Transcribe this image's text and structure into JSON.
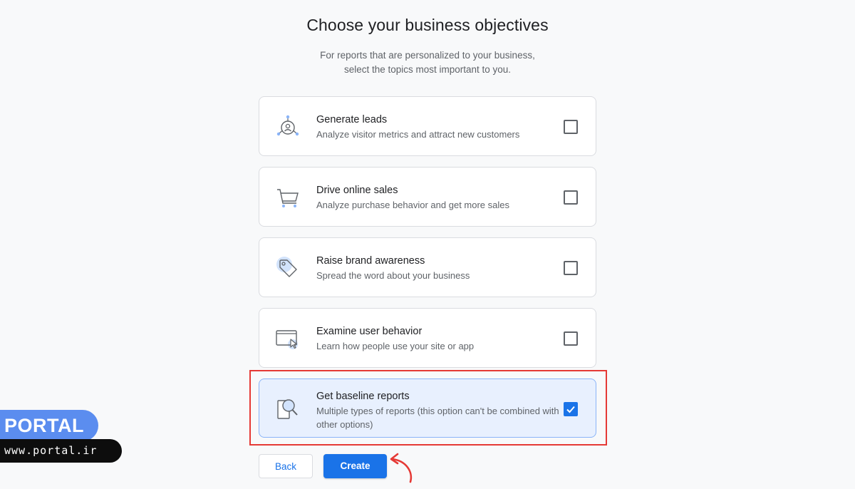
{
  "header": {
    "title": "Choose your business objectives",
    "subtitle_line1": "For reports that are personalized to your business,",
    "subtitle_line2": "select the topics most important to you."
  },
  "objectives": [
    {
      "title": "Generate leads",
      "description": "Analyze visitor metrics and attract new customers",
      "icon": "leads-icon",
      "checked": false
    },
    {
      "title": "Drive online sales",
      "description": "Analyze purchase behavior and get more sales",
      "icon": "cart-icon",
      "checked": false
    },
    {
      "title": "Raise brand awareness",
      "description": "Spread the word about your business",
      "icon": "tag-icon",
      "checked": false
    },
    {
      "title": "Examine user behavior",
      "description": "Learn how people use your site or app",
      "icon": "browser-cursor-icon",
      "checked": false
    },
    {
      "title": "Get baseline reports",
      "description": "Multiple types of reports (this option can't be combined with other options)",
      "icon": "magnifier-report-icon",
      "checked": true
    }
  ],
  "buttons": {
    "back": "Back",
    "create": "Create"
  },
  "watermark": {
    "brand": "PORTAL",
    "url": "www.portal.ir"
  },
  "colors": {
    "accent": "#1a73e8",
    "selected_bg": "#e8f0fe",
    "highlight": "#e53935",
    "badge": "#5b8def"
  }
}
